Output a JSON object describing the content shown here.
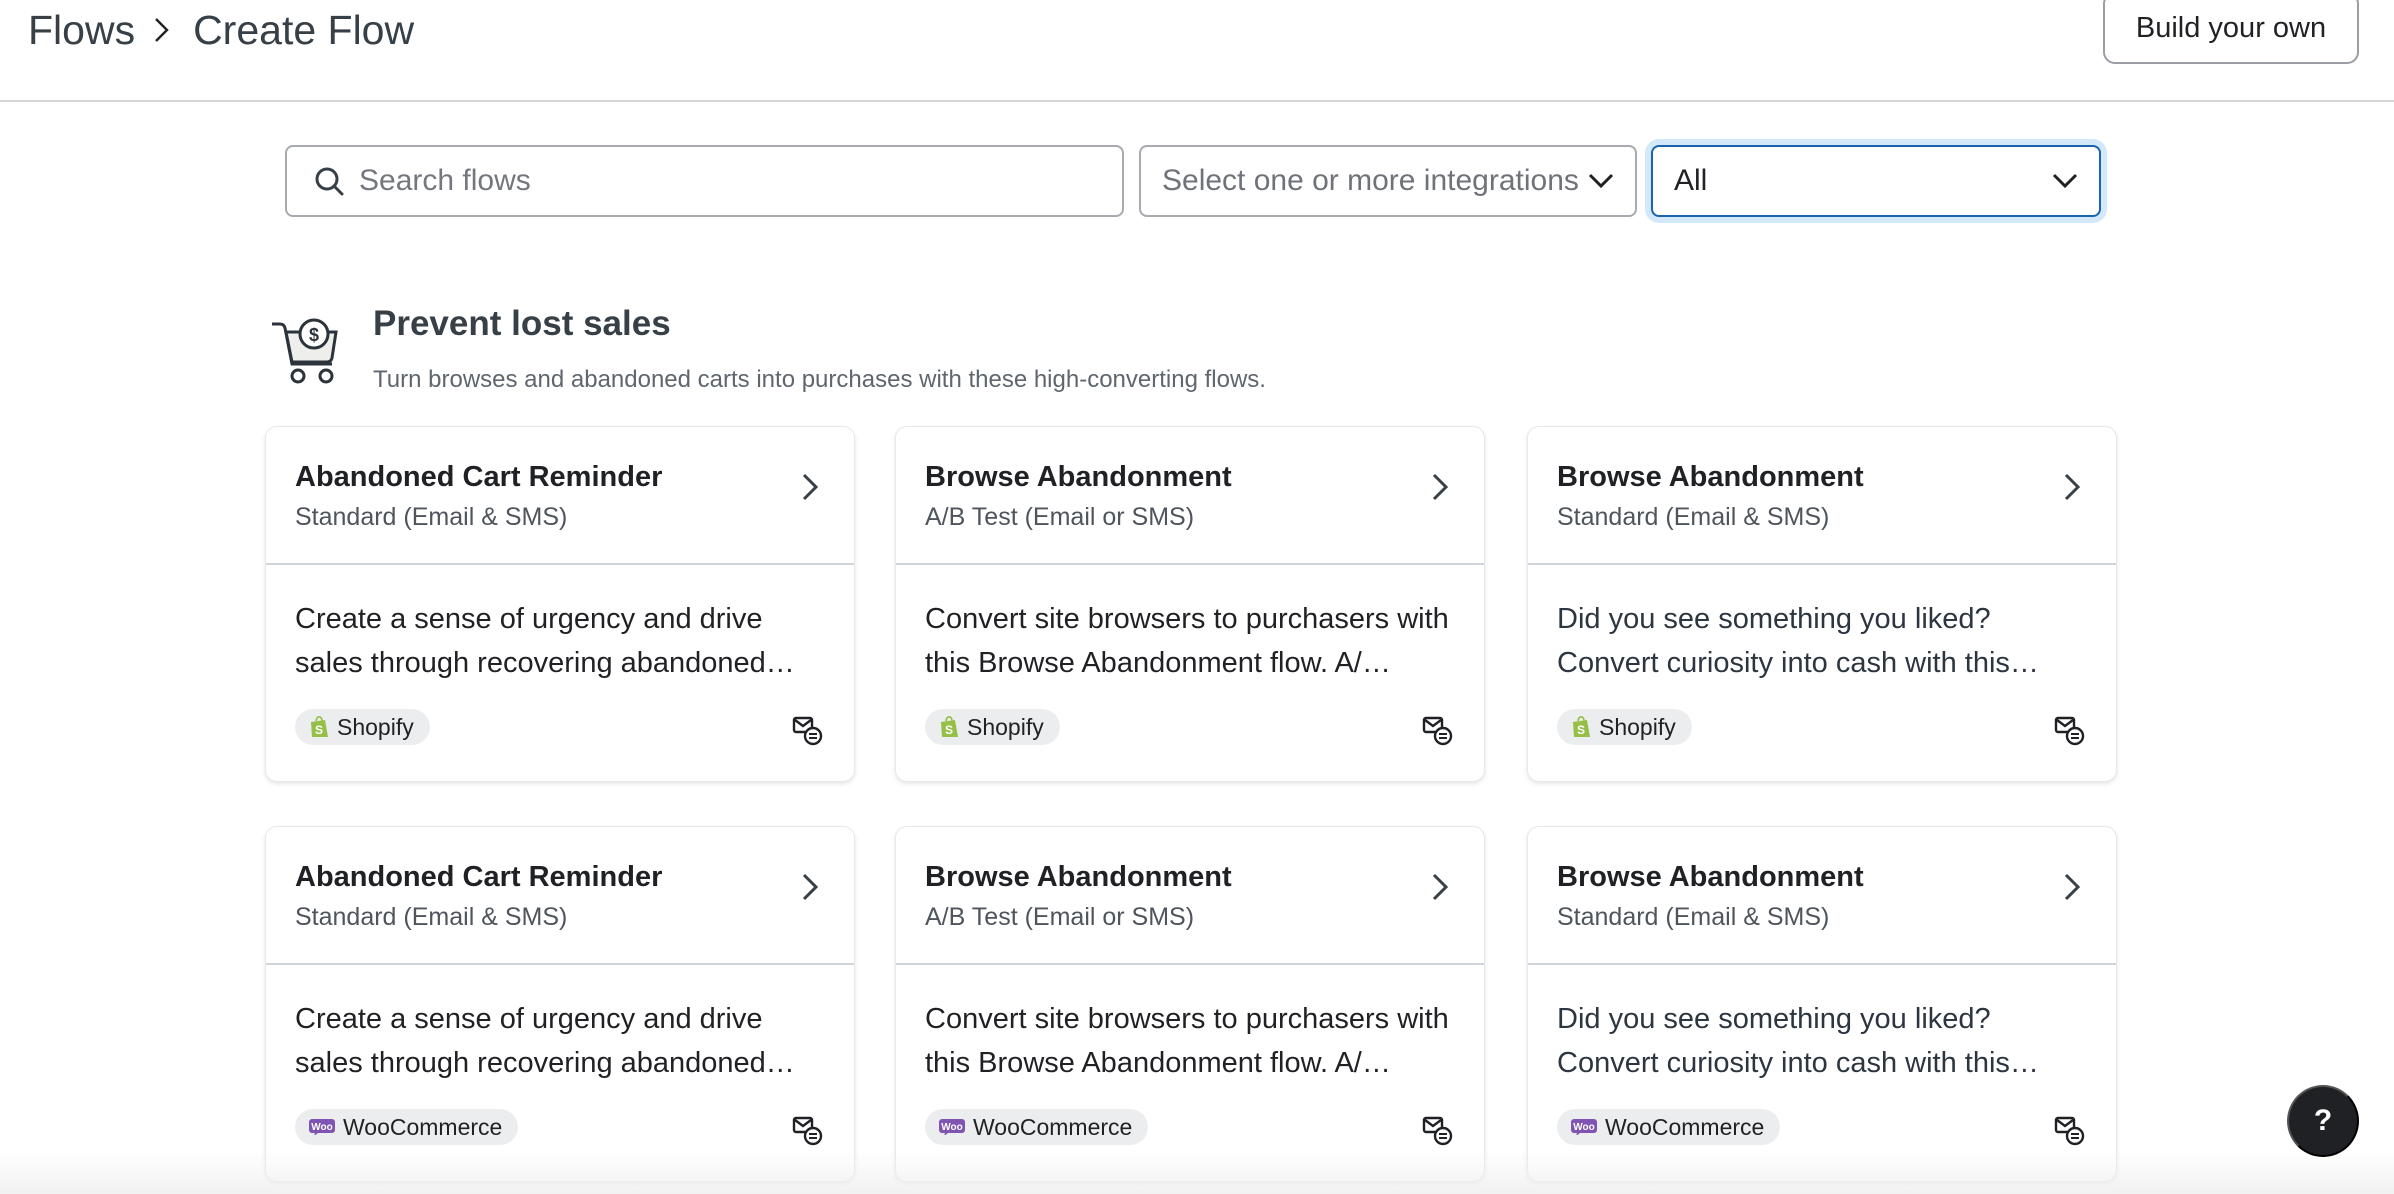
{
  "header": {
    "breadcrumb": [
      {
        "label": "Flows"
      },
      {
        "label": "Create Flow"
      }
    ],
    "build_button_label": "Build your own"
  },
  "filters": {
    "search": {
      "placeholder": "Search flows",
      "value": "",
      "icon": "search-icon"
    },
    "integrations": {
      "placeholder": "Select one or more integrations",
      "icon": "chevron-down-icon"
    },
    "category": {
      "value": "All",
      "icon": "chevron-down-icon",
      "focused": true
    }
  },
  "section": {
    "icon": "shopping-cart-dollar-icon",
    "title": "Prevent lost sales",
    "description": "Turn browses and abandoned carts into purchases with these high-converting flows."
  },
  "cards": [
    {
      "title": "Abandoned Cart Reminder",
      "subtitle": "Standard (Email & SMS)",
      "description": "Create a sense of urgency and drive sales through recovering abandoned carts.",
      "description_visible": "Create a sense of urgency and drive sales through recovering abandoned…",
      "integration": "Shopify",
      "integration_icon": "shopify-icon",
      "channel_icon": "email-sms-icon"
    },
    {
      "title": "Browse Abandonment",
      "subtitle": "A/B Test (Email or SMS)",
      "description_visible": "Convert site browsers to purchasers with this Browse Abandonment flow. A/…",
      "integration": "Shopify",
      "integration_icon": "shopify-icon",
      "channel_icon": "email-sms-icon"
    },
    {
      "title": "Browse Abandonment",
      "subtitle": "Standard (Email & SMS)",
      "description_visible": "Did you see something you liked? Convert curiosity into cash with this…",
      "integration": "Shopify",
      "integration_icon": "shopify-icon",
      "channel_icon": "email-sms-icon"
    },
    {
      "title": "Abandoned Cart Reminder",
      "subtitle": "Standard (Email & SMS)",
      "description_visible": "Create a sense of urgency and drive sales through recovering abandoned…",
      "integration": "WooCommerce",
      "integration_icon": "woocommerce-icon",
      "channel_icon": "email-sms-icon"
    },
    {
      "title": "Browse Abandonment",
      "subtitle": "A/B Test (Email or SMS)",
      "description_visible": "Convert site browsers to purchasers with this Browse Abandonment flow. A/…",
      "integration": "WooCommerce",
      "integration_icon": "woocommerce-icon",
      "channel_icon": "email-sms-icon"
    },
    {
      "title": "Browse Abandonment",
      "subtitle": "Standard (Email & SMS)",
      "description_visible": "Did you see something you liked? Convert curiosity into cash with this…",
      "integration": "WooCommerce",
      "integration_icon": "woocommerce-icon",
      "channel_icon": "email-sms-icon"
    }
  ],
  "help_button": {
    "label": "?"
  },
  "colors": {
    "focus_border": "#1c63ad",
    "focus_ring": "#d3e9f9",
    "shopify_green": "#95bf47",
    "woocommerce_purple": "#7f54b3",
    "help_bg": "#1f2124"
  }
}
